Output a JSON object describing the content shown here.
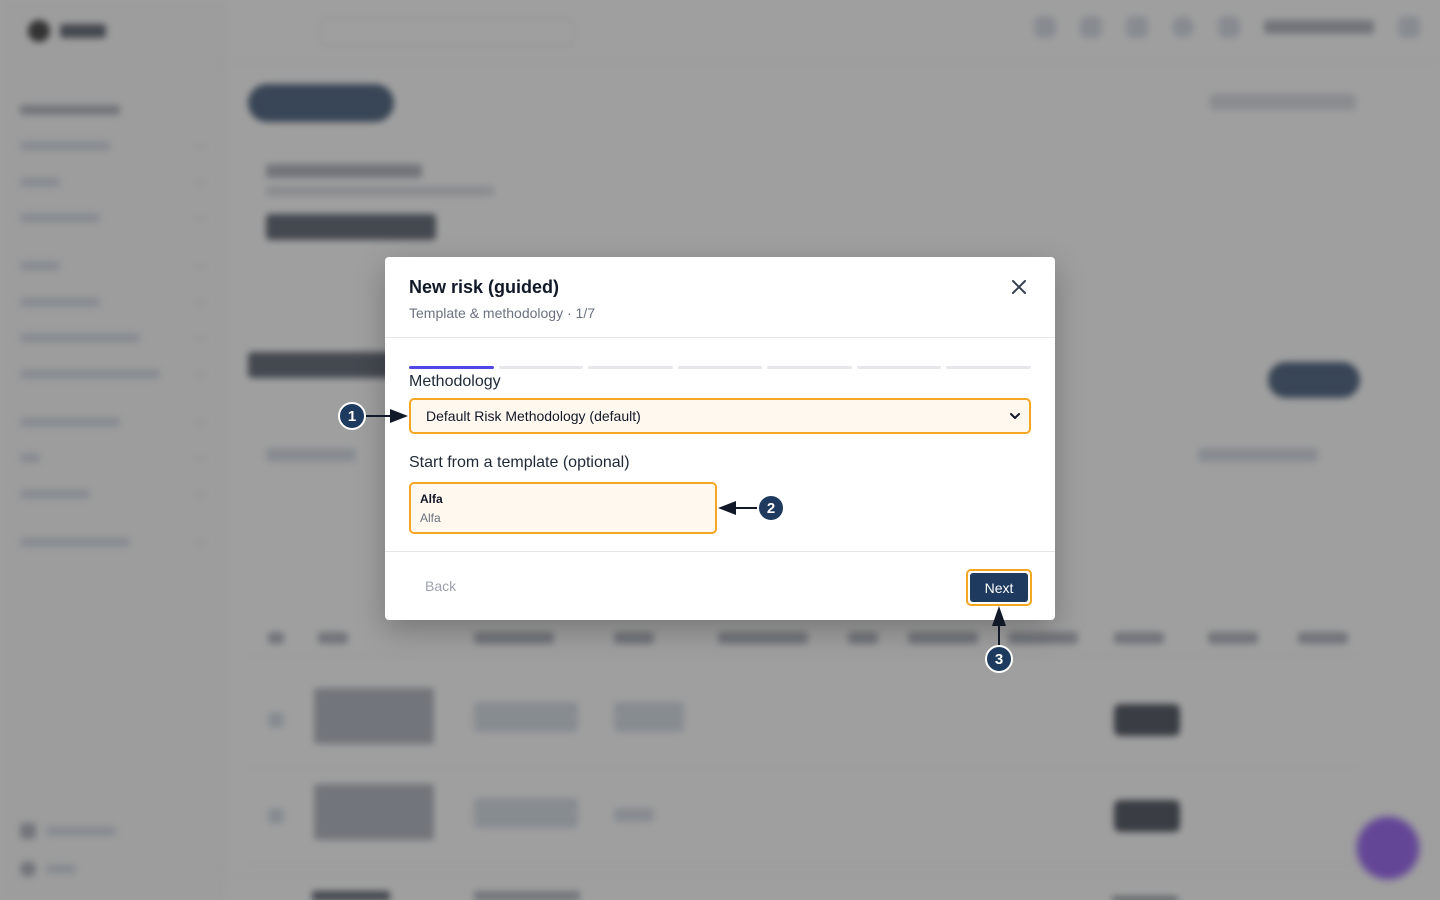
{
  "modal": {
    "title": "New risk (guided)",
    "subtitle": "Template & methodology · 1/7",
    "step_count": 7,
    "current_step": 1,
    "methodology_label": "Methodology",
    "methodology_value": "Default Risk Methodology (default)",
    "template_label": "Start from a template (optional)",
    "template": {
      "name": "Alfa",
      "description": "Alfa"
    },
    "back_label": "Back",
    "next_label": "Next"
  },
  "annotations": {
    "callout_1": "1",
    "callout_2": "2",
    "callout_3": "3"
  },
  "colors": {
    "accent": "#f5a623",
    "primary": "#1e3a5f",
    "progress": "#4f46e5"
  },
  "icons": {
    "close": "close-icon",
    "dropdown": "chevron-down-icon"
  }
}
